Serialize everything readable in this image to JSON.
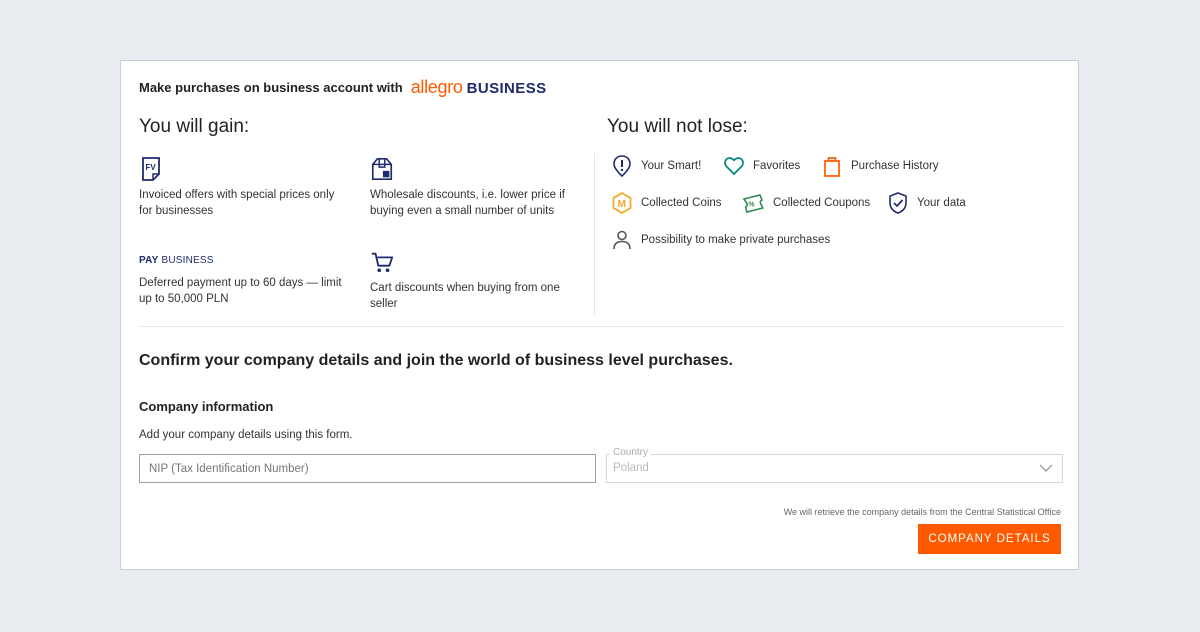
{
  "header": {
    "intro": "Make purchases on business account with",
    "brand_allegro": "allegro",
    "brand_business": "BUSINESS"
  },
  "gain": {
    "title": "You will gain:",
    "items": [
      {
        "icon": "invoice-fv-icon",
        "text": "Invoiced offers with special prices only for businesses"
      },
      {
        "icon": "wholesale-box-icon",
        "text": "Wholesale discounts, i.e. lower price if buying even a small number of units"
      },
      {
        "icon": "pay-business-logo",
        "badge_bold": "PAY",
        "badge_text": "BUSINESS",
        "text": "Deferred payment up to 60 days — limit up to 50,000 PLN"
      },
      {
        "icon": "cart-icon",
        "text": "Cart discounts when buying from one seller"
      }
    ]
  },
  "lose": {
    "title": "You will not lose:",
    "items": [
      {
        "icon": "smart-icon",
        "text": "Your Smart!"
      },
      {
        "icon": "heart-icon",
        "text": "Favorites"
      },
      {
        "icon": "shopping-bag-icon",
        "text": "Purchase History"
      },
      {
        "icon": "coin-icon",
        "text": "Collected Coins"
      },
      {
        "icon": "coupon-icon",
        "text": "Collected Coupons"
      },
      {
        "icon": "shield-check-icon",
        "text": "Your data"
      },
      {
        "icon": "person-icon",
        "text": "Possibility to make private purchases"
      }
    ]
  },
  "confirm": {
    "headline": "Confirm your company details and join the world of business level purchases."
  },
  "company": {
    "title": "Company information",
    "description": "Add your company details using this form.",
    "nip_placeholder": "NIP (Tax Identification Number)",
    "nip_value": "",
    "country_label": "Country",
    "country_value": "Poland",
    "note": "We will retrieve the company details from the Central Statistical Office",
    "button_label": "COMPANY DETAILS"
  },
  "colors": {
    "accent": "#ff5a00",
    "navy": "#1f2b6e",
    "green": "#2e8b57",
    "teal": "#00857a",
    "coin": "#f5a623"
  }
}
